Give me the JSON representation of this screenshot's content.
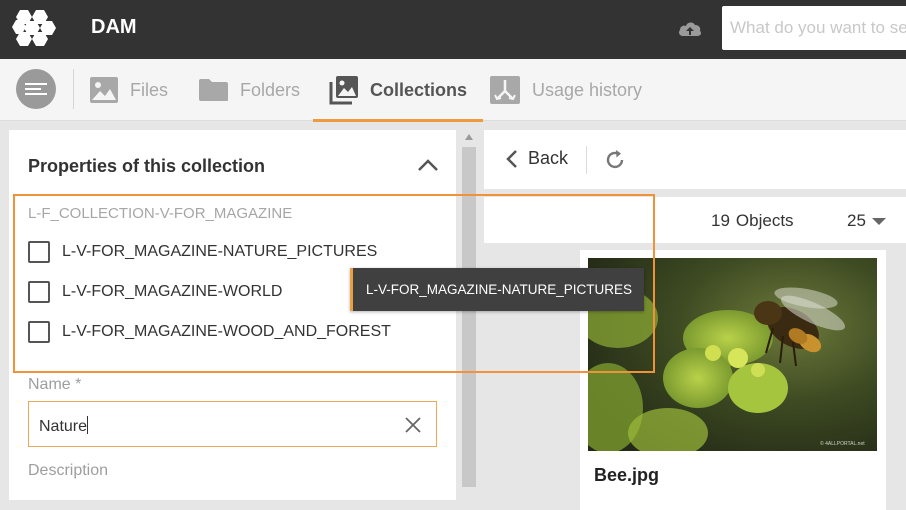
{
  "header": {
    "app_title": "DAM",
    "search_placeholder": "What do you want to search",
    "upload_icon": "cloud-upload-icon"
  },
  "nav": {
    "menu_icon": "menu-lines-icon",
    "tabs": [
      {
        "label": "Files",
        "icon": "image-icon",
        "active": false
      },
      {
        "label": "Folders",
        "icon": "folder-icon",
        "active": false
      },
      {
        "label": "Collections",
        "icon": "images-stack-icon",
        "active": true
      },
      {
        "label": "Usage history",
        "icon": "usage-history-icon",
        "active": false
      }
    ],
    "accent_color": "#f09a3e"
  },
  "properties": {
    "title": "Properties of this collection",
    "group_label": "L-F_COLLECTION-V-FOR_MAGAZINE",
    "options": [
      {
        "label": "L-V-FOR_MAGAZINE-NATURE_PICTURES",
        "checked": false
      },
      {
        "label": "L-V-FOR_MAGAZINE-WORLD",
        "checked": false
      },
      {
        "label": "L-V-FOR_MAGAZINE-WOOD_AND_FOREST",
        "checked": false
      }
    ],
    "name_label": "Name *",
    "name_value": "Nature",
    "description_label": "Description"
  },
  "tooltip": {
    "text": "L-V-FOR_MAGAZINE-NATURE_PICTURES"
  },
  "results": {
    "back_label": "Back",
    "object_count": "19",
    "objects_label": "Objects",
    "per_page": "25",
    "files": [
      {
        "name": "Bee.jpg",
        "watermark": "© 4ALLPORTAL.net"
      }
    ]
  }
}
